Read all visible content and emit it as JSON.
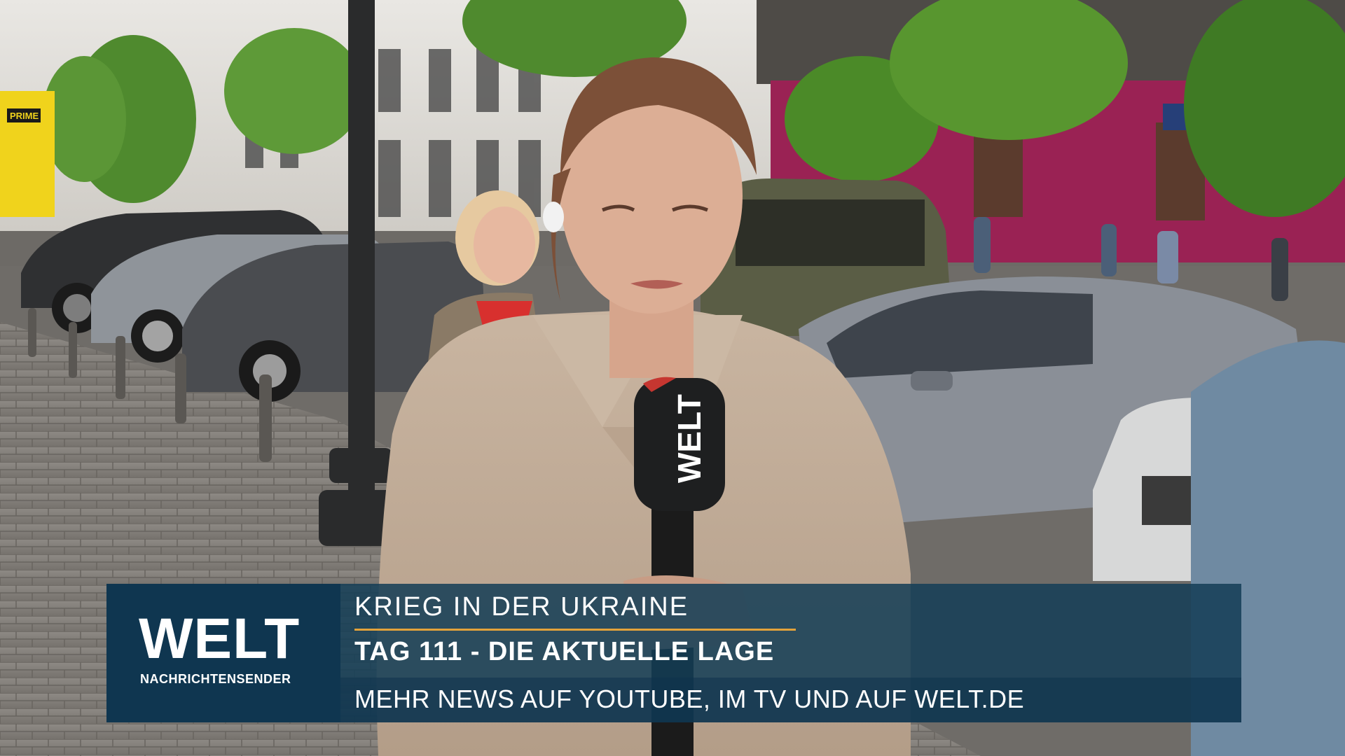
{
  "scene": {
    "description_icons": [
      "street-background",
      "reporter",
      "welt-microphone",
      "parked-cars",
      "lamp-post",
      "trees",
      "passerby"
    ],
    "sign_text": "PRIME",
    "mic_label": "WELT"
  },
  "lower_third": {
    "logo": "WELT",
    "logo_sub": "NACHRICHTENSENDER",
    "topic": "KRIEG IN DER UKRAINE",
    "headline": "TAG 111 - DIE AKTUELLE LAGE",
    "ticker": "MEHR NEWS AUF YOUTUBE, IM TV UND AUF WELT.DE",
    "colors": {
      "logo_bg": "#0f3650",
      "band": "#143e56",
      "accent": "#e3a23b",
      "text": "#ffffff"
    }
  }
}
